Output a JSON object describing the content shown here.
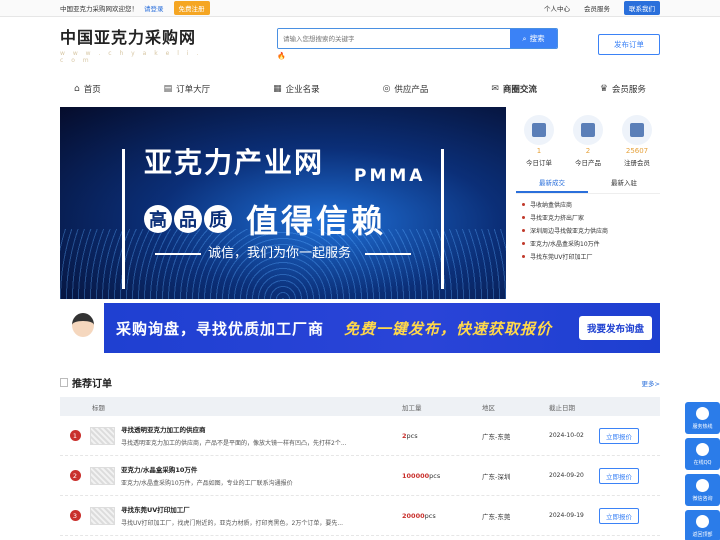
{
  "topbar": {
    "welcome": "中国亚克力采购网欢迎您！",
    "login": "请登录",
    "register": "免费注册",
    "user_center": "个人中心",
    "member_service": "会员服务",
    "contact": "联系我们"
  },
  "header": {
    "logo_name": "中国亚克力采购网",
    "logo_url": "w w w . c h y a k e l i . c o m",
    "search_placeholder": "请输入您想搜索的关键字",
    "search_button": "搜索",
    "hot_icon": "🔥",
    "publish_button": "发布订单"
  },
  "nav": [
    {
      "label": "首页",
      "icon": "⌂",
      "icon_name": "home-icon"
    },
    {
      "label": "订单大厅",
      "icon": "▤",
      "icon_name": "order-icon"
    },
    {
      "label": "企业名录",
      "icon": "▦",
      "icon_name": "company-icon"
    },
    {
      "label": "供应产品",
      "icon": "◎",
      "icon_name": "product-icon"
    },
    {
      "label": "商圈交流",
      "icon": "✉",
      "icon_name": "megaphone-icon"
    },
    {
      "label": "会员服务",
      "icon": "♛",
      "icon_name": "member-icon"
    }
  ],
  "banner": {
    "title": "亚克力产业网",
    "tag": "PMMA",
    "chars": [
      "高",
      "品",
      "质"
    ],
    "slogan": "值得信赖",
    "sub": "诚信，我们为你一起服务"
  },
  "stats": [
    {
      "num": "1",
      "label": "今日订单"
    },
    {
      "num": "2",
      "label": "今日产品"
    },
    {
      "num": "25607",
      "label": "注册会员"
    }
  ],
  "side_tabs": {
    "tab1": "最新成交",
    "tab2": "最新入驻"
  },
  "side_list": [
    "寻收纳盒供应商",
    "寻找亚克力挤出厂家",
    "深圳周边寻找做亚克力供应商",
    "亚克力/水晶盒采购10万件",
    "寻找东莞UV打印加工厂"
  ],
  "ad": {
    "text1": "采购询盘，寻找优质加工厂商",
    "text2": "免费一键发布，快速获取报价",
    "button": "我要发布询盘"
  },
  "recommended": {
    "title": "推荐订单",
    "more": "更多>",
    "headers": {
      "title": "标题",
      "qty": "加工量",
      "area": "地区",
      "date": "截止日期"
    },
    "rows": [
      {
        "idx": "1",
        "name": "寻找透明亚克力加工的供应商",
        "desc": "寻找透明亚克力加工的供应商，产品不是平面的，像放大镜一样有凹凸，先打样2个...",
        "qty": "2",
        "unit": "pcs",
        "area": "广东-东莞",
        "date": "2024-10-02",
        "action": "立即报价"
      },
      {
        "idx": "2",
        "name": "亚克力/水晶盒采购10万件",
        "desc": "亚克力/水晶盒采购10万件，产品如图，专业的工厂联系沟通报价",
        "qty": "100000",
        "unit": "pcs",
        "area": "广东-深圳",
        "date": "2024-09-20",
        "action": "立即报价"
      },
      {
        "idx": "3",
        "name": "寻找东莞UV打印加工厂",
        "desc": "寻找UV打印加工厂，找虎门附近的，亚克力材质，打印亮黑色，2万个订单，要先...",
        "qty": "20000",
        "unit": "pcs",
        "area": "广东-东莞",
        "date": "2024-09-19",
        "action": "立即报价"
      }
    ]
  },
  "float": [
    {
      "label": "服务热线",
      "icon_name": "phone-icon"
    },
    {
      "label": "在线QQ",
      "icon_name": "qq-icon"
    },
    {
      "label": "微信咨询",
      "icon_name": "wechat-icon"
    },
    {
      "label": "返回顶部",
      "icon_name": "top-icon"
    }
  ]
}
